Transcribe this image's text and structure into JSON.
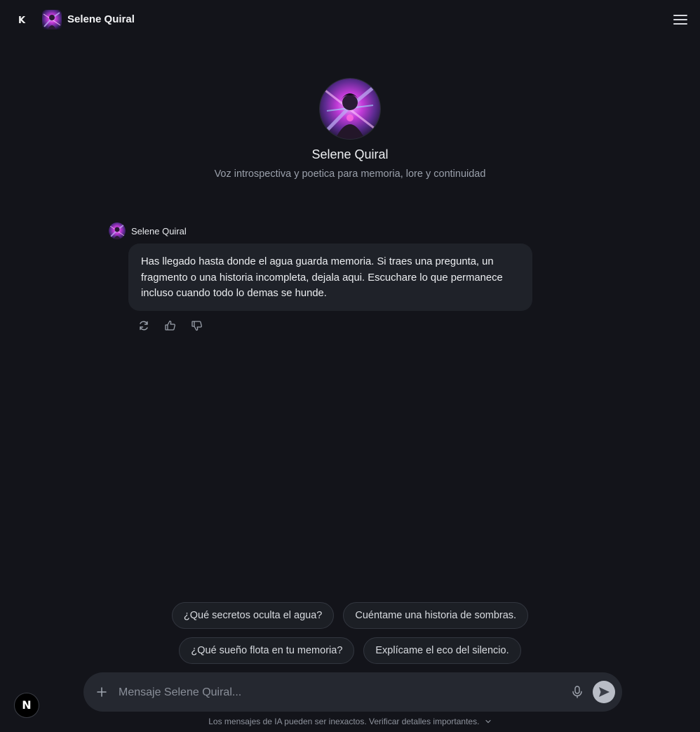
{
  "header": {
    "logo_letter": "K",
    "title": "Selene Quiral",
    "menu_icon": "hamburger-menu-icon"
  },
  "profile": {
    "name": "Selene Quiral",
    "description": "Voz introspectiva y poetica para memoria, lore y continuidad"
  },
  "message": {
    "author": "Selene Quiral",
    "text": "Has llegado hasta donde el agua guarda memoria. Si traes una pregunta, un fragmento o una historia incompleta, dejala aqui. Escuchare lo que permanece incluso cuando todo lo demas se hunde.",
    "actions": [
      "regenerate-icon",
      "thumbs-up-icon",
      "thumbs-down-icon"
    ]
  },
  "suggestions": {
    "row1": [
      "¿Qué secretos oculta el agua?",
      "Cuéntame una historia de sombras."
    ],
    "row2": [
      "¿Qué sueño flota en tu memoria?",
      "Explícame el eco del silencio."
    ]
  },
  "composer": {
    "placeholder": "Mensaje Selene Quiral...",
    "value": ""
  },
  "footer": {
    "disclaimer": "Los mensajes de IA pueden ser inexactos. Verificar detalles importantes.",
    "badge_letter": "N"
  },
  "colors": {
    "background": "#13141a",
    "bubble": "#1f2229",
    "chip_border": "#32363f",
    "avatar_accent": "#d44fe0"
  }
}
